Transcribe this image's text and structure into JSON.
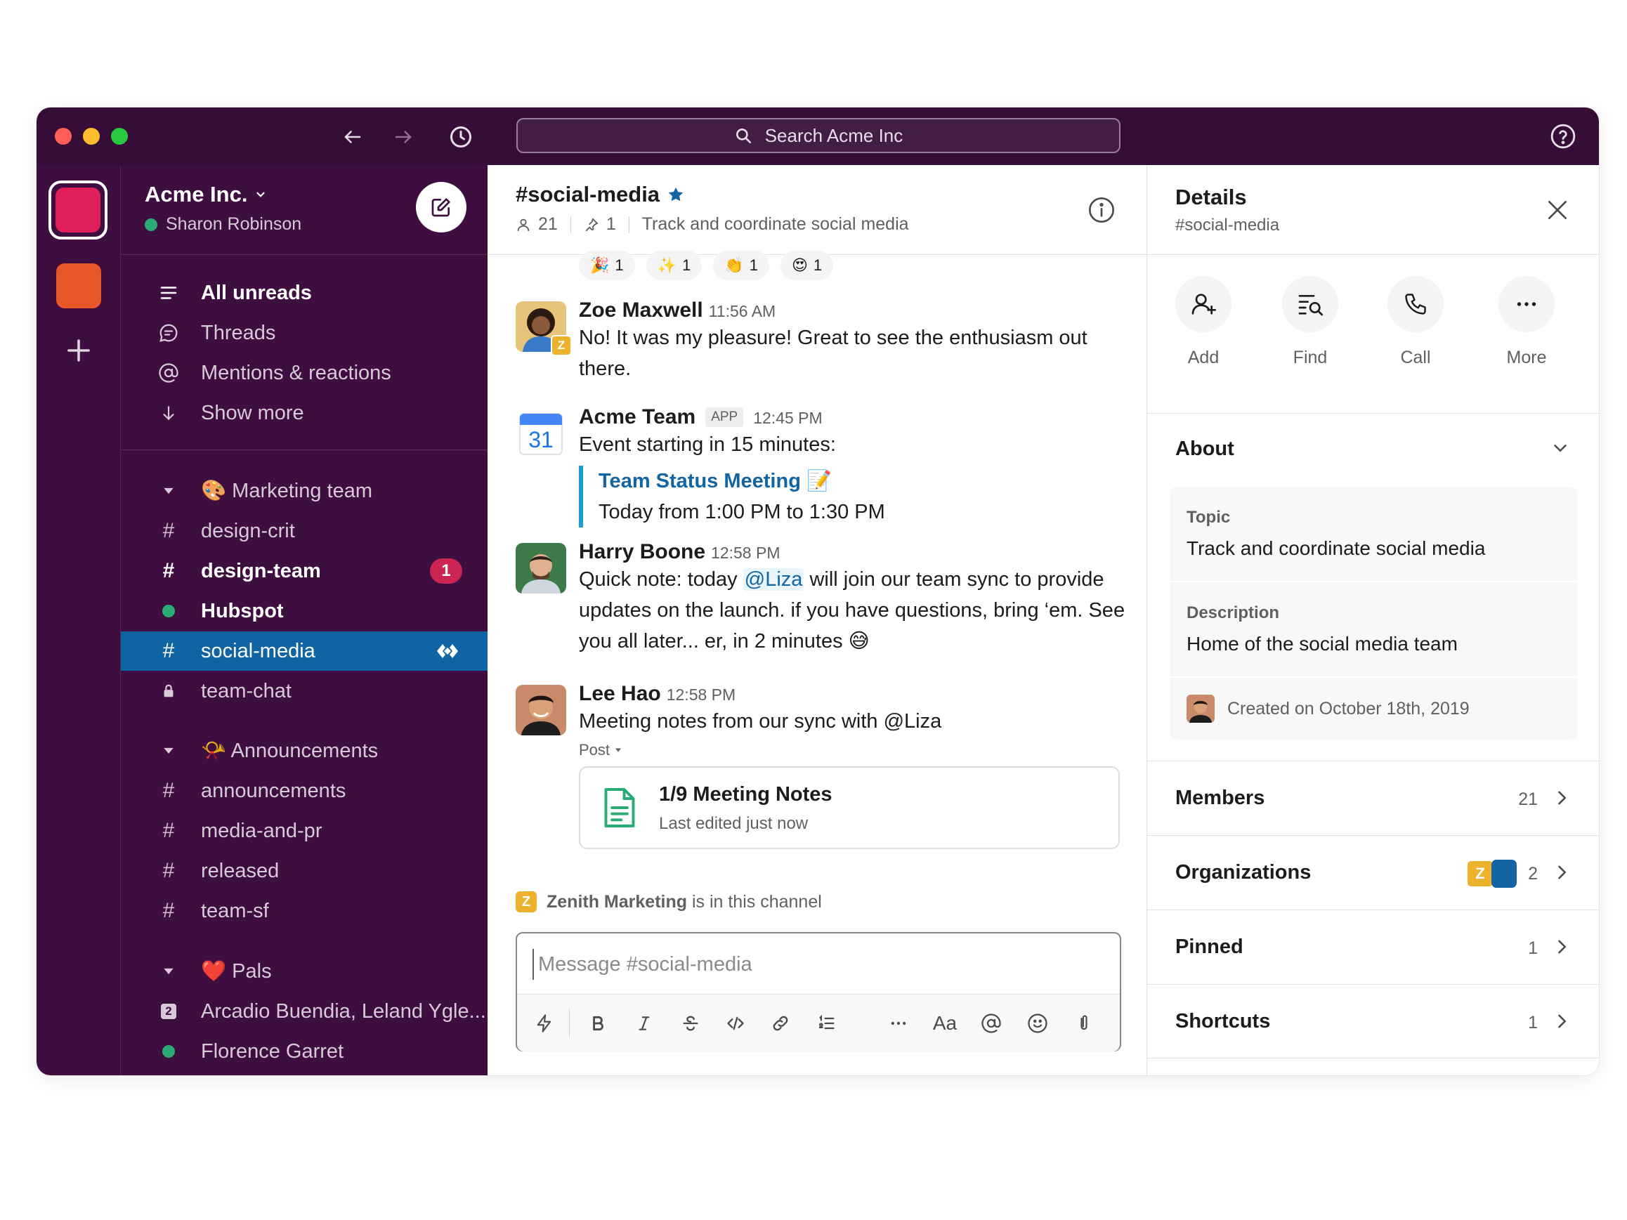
{
  "window": {
    "search_placeholder": "Search Acme Inc",
    "traffic_colors": [
      "#ff5f57",
      "#febc2e",
      "#28c840"
    ]
  },
  "workspace": {
    "name": "Acme Inc.",
    "user": "Sharon Robinson",
    "colors": {
      "active": "#e01e5a",
      "secondary": "#e8562a"
    }
  },
  "sidebar": {
    "nav": [
      {
        "label": "All unreads",
        "icon": "list-icon",
        "bold": true
      },
      {
        "label": "Threads",
        "icon": "threads-icon"
      },
      {
        "label": "Mentions & reactions",
        "icon": "at-icon"
      },
      {
        "label": "Show more",
        "icon": "arrow-down-icon"
      }
    ],
    "sections": [
      {
        "title": "🎨 Marketing team",
        "items": [
          {
            "label": "design-crit",
            "prefix": "#"
          },
          {
            "label": "design-team",
            "prefix": "#",
            "bold": true,
            "badge": "1"
          },
          {
            "label": "Hubspot",
            "prefix": "dot",
            "bold": true
          },
          {
            "label": "social-media",
            "prefix": "#",
            "active": true
          },
          {
            "label": "team-chat",
            "prefix": "lock"
          }
        ]
      },
      {
        "title": "📯 Announcements",
        "items": [
          {
            "label": "announcements",
            "prefix": "#"
          },
          {
            "label": "media-and-pr",
            "prefix": "#"
          },
          {
            "label": "released",
            "prefix": "#"
          },
          {
            "label": "team-sf",
            "prefix": "#"
          }
        ]
      },
      {
        "title": "❤️ Pals",
        "items": [
          {
            "label": "Arcadio Buendia, Leland Ygle...",
            "prefix": "2"
          },
          {
            "label": "Florence Garret",
            "prefix": "dot"
          }
        ]
      }
    ]
  },
  "channel": {
    "name": "#social-media",
    "members": "21",
    "pins": "1",
    "topic": "Track and coordinate social media",
    "reactions": [
      {
        "emoji": "🎉",
        "count": "1"
      },
      {
        "emoji": "✨",
        "count": "1"
      },
      {
        "emoji": "👏",
        "count": "1"
      },
      {
        "emoji": "😍",
        "count": "1"
      }
    ],
    "messages": {
      "zoe": {
        "name": "Zoe Maxwell",
        "time": "11:56 AM",
        "text": "No! It was my pleasure! Great to see the enthusiasm out there."
      },
      "acme": {
        "name": "Acme Team",
        "tag": "APP",
        "time": "12:45 PM",
        "text": "Event starting in 15 minutes:",
        "calendar_day": "31",
        "event_title": "Team Status Meeting 📝",
        "event_time": "Today from 1:00 PM to 1:30 PM"
      },
      "harry": {
        "name": "Harry Boone",
        "time": "12:58 PM",
        "pre": "Quick note: today ",
        "mention": "@Liza",
        "post": " will join our team sync to provide updates on the launch. if you have questions, bring ‘em. See you all later... er, in 2 minutes 😅"
      },
      "lee": {
        "name": "Lee Hao",
        "time": "12:58 PM",
        "text": "Meeting notes from our sync with @Liza",
        "post_label": "Post",
        "post_title": "1/9 Meeting Notes",
        "post_sub": "Last edited just now"
      }
    },
    "notice": {
      "org": "Zenith Marketing",
      "suffix": " is in this channel",
      "badge": "Z"
    },
    "composer_placeholder": "Message #social-media",
    "format_aa": "Aa"
  },
  "details": {
    "title": "Details",
    "subtitle": "#social-media",
    "actions": [
      "Add",
      "Find",
      "Call",
      "More"
    ],
    "about": {
      "heading": "About",
      "topic_label": "Topic",
      "topic": "Track and coordinate social media",
      "description_label": "Description",
      "description": "Home of the social media team",
      "created": "Created on October 18th, 2019"
    },
    "rows": [
      {
        "label": "Members",
        "count": "21"
      },
      {
        "label": "Organizations",
        "count": "2"
      },
      {
        "label": "Pinned",
        "count": "1"
      },
      {
        "label": "Shortcuts",
        "count": "1"
      }
    ]
  }
}
